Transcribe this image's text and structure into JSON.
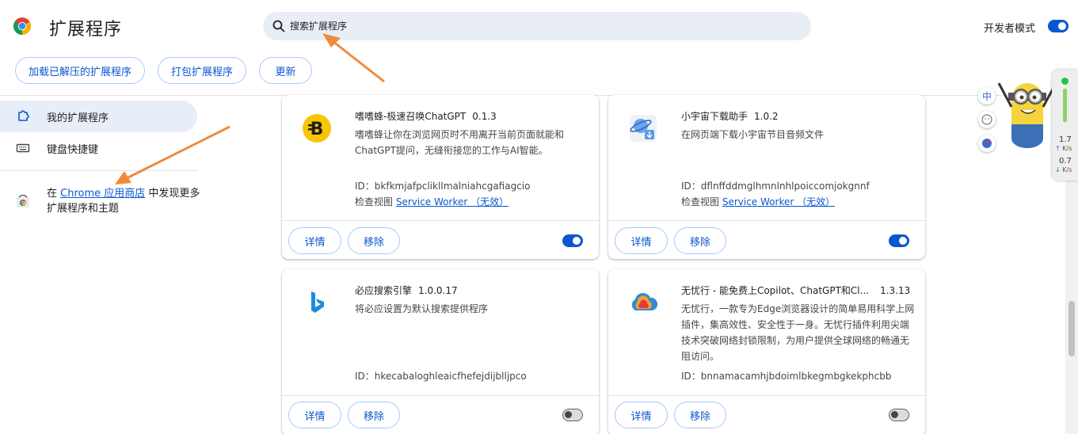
{
  "header": {
    "title": "扩展程序",
    "search_placeholder": "搜索扩展程序",
    "dev_mode_label": "开发者模式",
    "dev_mode_on": true
  },
  "toolbar": {
    "load_unpacked": "加载已解压的扩展程序",
    "pack": "打包扩展程序",
    "update": "更新"
  },
  "sidebar": {
    "items": [
      {
        "label": "我的扩展程序",
        "icon": "extension-icon",
        "active": true
      },
      {
        "label": "键盘快捷键",
        "icon": "keyboard-icon",
        "active": false
      }
    ],
    "store_prefix": "在",
    "store_link": "Chrome 应用商店",
    "store_suffix": "中发现更多扩展程序和主题"
  },
  "cards": [
    {
      "name": "嗜嗜蜂-极速召唤ChatGPT",
      "version": "0.1.3",
      "description": "嗜嗜蜂让你在浏览网页时不用离开当前页面就能和ChatGPT提问，无缝衔接您的工作与AI智能。",
      "id": "ID：bkfkmjafpcliklImalniahcgafiagcio",
      "view_label": "检查视图",
      "view_link": "Service Worker （无效）",
      "details_label": "详情",
      "remove_label": "移除",
      "enabled": true,
      "icon": "bee-b-icon"
    },
    {
      "name": "小宇宙下载助手",
      "version": "1.0.2",
      "description": "在网页端下载小宇宙节目音频文件",
      "id": "ID：dflnffddmglhmnlnhlpoiccomjokgnnf",
      "view_label": "检查视图",
      "view_link": "Service Worker （无效）",
      "details_label": "详情",
      "remove_label": "移除",
      "enabled": true,
      "icon": "planet-download-icon"
    },
    {
      "name": "必应搜索引擎",
      "version": "1.0.0.17",
      "description": "将必应设置为默认搜索提供程序",
      "id": "ID：hkecabaloghleaicfhefejdijblljpco",
      "details_label": "详情",
      "remove_label": "移除",
      "enabled": false,
      "icon": "bing-icon"
    },
    {
      "name": "无忧行 - 能免费上Copilot、ChatGPT和Cl...",
      "version": "1.3.13",
      "description": "无忧行，一款专为Edge浏览器设计的简单易用科学上网插件，集高效性、安全性于一身。无忧行插件利用尖端技术突破网络封锁限制，为用户提供全球网络的畅通无阻访问。",
      "id": "ID：bnnamacamhjbdoimlbkegmbgkekphcbb",
      "details_label": "详情",
      "remove_label": "移除",
      "enabled": false,
      "icon": "cloud-icon"
    }
  ],
  "widgets": {
    "ime_label": "中",
    "upload_speed": "1.7",
    "download_speed": "0.7",
    "speed_unit": "K/s"
  },
  "colors": {
    "accent": "#0b57d0",
    "search_bg": "#e9eef6",
    "sidebar_active": "#e8eef8",
    "arrow": "#f08a3c"
  }
}
